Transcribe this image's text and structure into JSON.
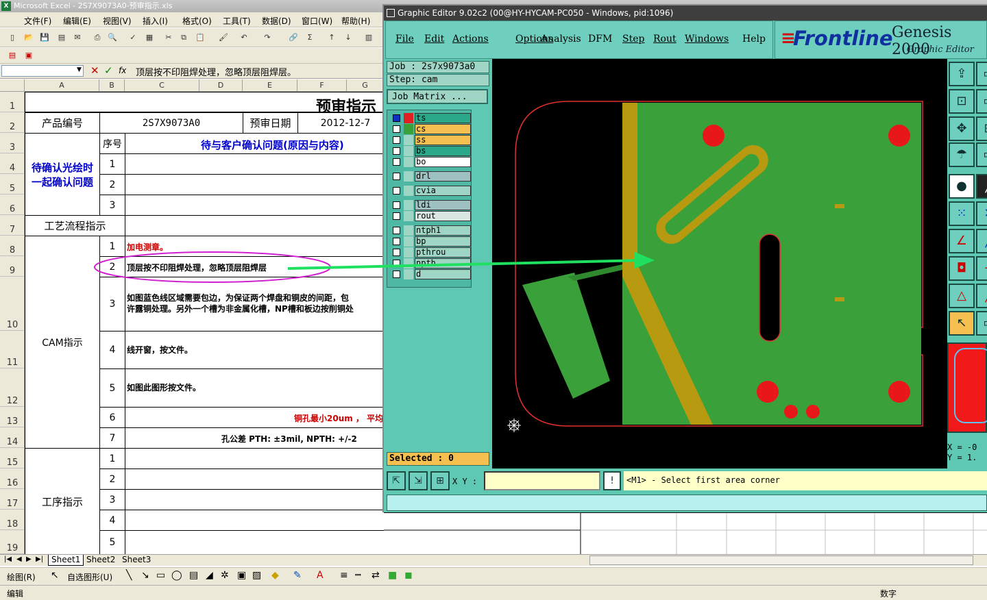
{
  "excel": {
    "title": "Microsoft Excel - 2S7X9073A0-预审指示.xls",
    "menu": [
      "文件(F)",
      "编辑(E)",
      "视图(V)",
      "插入(I)",
      "格式(O)",
      "工具(T)",
      "数据(D)",
      "窗口(W)",
      "帮助(H)"
    ],
    "formula": "顶层按不印阻焊处理，忽略顶层阻焊层。",
    "columns": [
      "A",
      "B",
      "C",
      "D",
      "E",
      "F",
      "G"
    ],
    "rows": [
      "1",
      "2",
      "3",
      "4",
      "5",
      "6",
      "7",
      "8",
      "9",
      "10",
      "11",
      "12",
      "13",
      "14",
      "15",
      "16",
      "17",
      "18",
      "19"
    ],
    "cells": {
      "title": "预审指示",
      "product_no_label": "产品编号",
      "product_no": "2S7X9073A0",
      "review_date_label": "预审日期",
      "review_date": "2012-12-7",
      "seq_label": "序号",
      "pending_header": "待与客户确认问题(原因与内容)",
      "pending_label": "待确认光绘时一起确认问题",
      "process_label": "工艺流程指示",
      "cam_label": "CAM指示",
      "procedure_label": "工序指示",
      "pending_nums": [
        "1",
        "2",
        "3"
      ],
      "cam_nums": [
        "1",
        "2",
        "3",
        "4",
        "5",
        "6",
        "7"
      ],
      "cam_items": [
        "加电测章。",
        "顶层按不印阻焊处理，忽略顶层阻焊层",
        "如图蓝色线区域需要包边，为保证两个焊盘和铜皮的间距，包",
        "许露铜处理。另外一个槽为非金属化槽，NP槽和板边按削铜处",
        "线开窗，按文件。",
        "如图此图形按文件。",
        "铜孔最小20um ， 平均",
        "孔公差 PTH: ±3mil, NPTH: +/-2"
      ],
      "procedure_nums": [
        "1",
        "2",
        "3",
        "4",
        "5"
      ]
    },
    "sheets": [
      "Sheet1",
      "Sheet2",
      "Sheet3"
    ],
    "draw_label": "绘图(R)",
    "autoshape_label": "自选图形(U)",
    "status_left": "编辑",
    "status_right": "数字"
  },
  "genesis": {
    "title": "Graphic Editor 9.02c2 (00@HY-HYCAM-PC050 - Windows, pid:1096)",
    "menu": [
      "File",
      "Edit",
      "Actions",
      "Options",
      "Analysis",
      "DFM",
      "Step",
      "Rout",
      "Windows",
      "Help"
    ],
    "logo": "Frontline",
    "product": "Genesis 2000",
    "subtitle": "Graphic Editor",
    "job": "Job  : 2s7x9073a0",
    "step": "Step: cam",
    "job_matrix": "Job Matrix ...",
    "layers": [
      {
        "name": "ts",
        "color": "#2aa889",
        "swatch": "#e02020"
      },
      {
        "name": "cs",
        "color": "#f5c050",
        "swatch": "#3aa03a"
      },
      {
        "name": "ss",
        "color": "#f5c050",
        "swatch": "#9ed5c5"
      },
      {
        "name": "bs",
        "color": "#2aa889",
        "swatch": "#9ed5c5"
      },
      {
        "name": "bo",
        "color": "#ffffff",
        "swatch": "#9ed5c5"
      },
      {
        "name": "drl",
        "color": "#9ec0c0",
        "swatch": "#9ed5c5"
      },
      {
        "name": "cvia",
        "color": "#9ed5c5",
        "swatch": "#9ed5c5"
      },
      {
        "name": "ldi",
        "color": "#9ec0c0",
        "swatch": "#9ed5c5"
      },
      {
        "name": "rout",
        "color": "#d9e6e2",
        "swatch": "#9ed5c5"
      },
      {
        "name": "ntph1",
        "color": "#9ed5c5",
        "swatch": "#9ed5c5"
      },
      {
        "name": "bp",
        "color": "#9ed5c5",
        "swatch": "#9ed5c5"
      },
      {
        "name": "pthrou",
        "color": "#9ed5c5",
        "swatch": "#9ed5c5"
      },
      {
        "name": "npth",
        "color": "#9ed5c5",
        "swatch": "#9ed5c5"
      },
      {
        "name": "d",
        "color": "#9ed5c5",
        "swatch": "#9ed5c5"
      }
    ],
    "selected": "Selected : 0",
    "xy_label": "X Y :",
    "prompt": "<M1> - Select first area corner",
    "coord_x": "X = -0",
    "coord_y": "Y = 1."
  }
}
